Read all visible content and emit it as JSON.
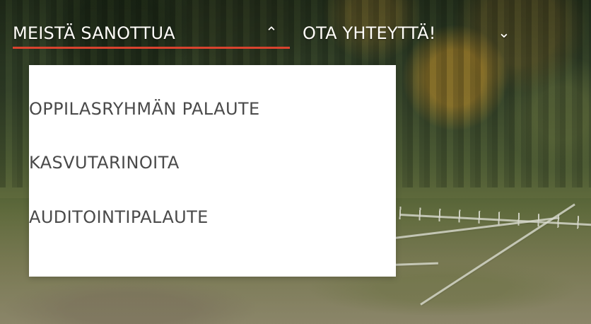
{
  "navigation": {
    "items": [
      {
        "label": "Meistä sanottua",
        "icon": "chevron-up-icon",
        "icon_glyph": "⌃",
        "active": true
      },
      {
        "label": "Ota yhteyttä!",
        "icon": "chevron-down-icon",
        "icon_glyph": "⌄",
        "active": false
      }
    ]
  },
  "dropdown": {
    "items": [
      {
        "label": "Oppilasryhmän palaute"
      },
      {
        "label": "Kasvutarinoita"
      },
      {
        "label": "Auditointipalaute"
      }
    ]
  },
  "colors": {
    "active_underline": "#d9432f",
    "menu_text": "#fffdf8",
    "dropdown_background": "#ffffff",
    "dropdown_text": "#4a4a4a"
  }
}
